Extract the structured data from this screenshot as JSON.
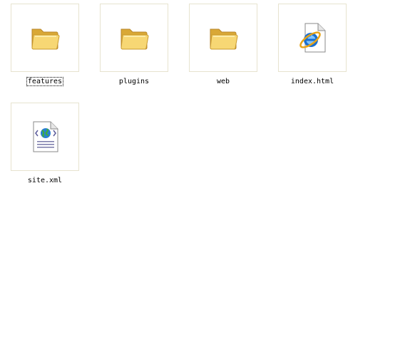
{
  "items": [
    {
      "name": "features",
      "type": "folder",
      "focused": true
    },
    {
      "name": "plugins",
      "type": "folder",
      "focused": false
    },
    {
      "name": "web",
      "type": "folder",
      "focused": false
    },
    {
      "name": "index.html",
      "type": "html-file",
      "focused": false
    },
    {
      "name": "site.xml",
      "type": "xml-file",
      "focused": false
    }
  ],
  "icons": {
    "folder": "folder-icon",
    "html_file": "internet-explorer-document-icon",
    "xml_file": "xml-document-icon"
  },
  "colors": {
    "thumb_border": "#e7e3cf",
    "folder_yellow": "#f7d774",
    "ie_blue": "#1a6fd0",
    "ie_ring": "#e8a317"
  }
}
